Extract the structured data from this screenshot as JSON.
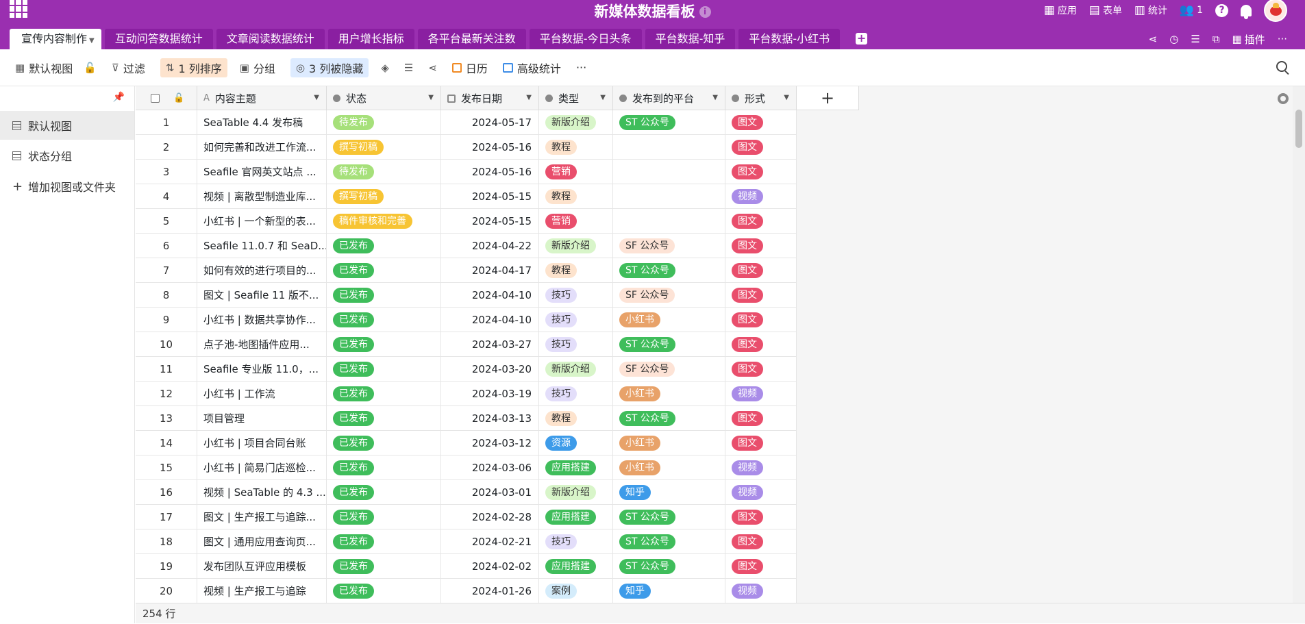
{
  "header": {
    "title": "新媒体数据看板",
    "info_icon": "i",
    "right": [
      {
        "icon": "apps-icon",
        "label": "应用"
      },
      {
        "icon": "form-icon",
        "label": "表单"
      },
      {
        "icon": "stats-icon",
        "label": "统计"
      },
      {
        "icon": "users-icon",
        "label": "1"
      }
    ],
    "help": "?"
  },
  "tabs": [
    {
      "label": "宣传内容制作",
      "active": true
    },
    {
      "label": "互动问答数据统计"
    },
    {
      "label": "文章阅读数据统计"
    },
    {
      "label": "用户增长指标"
    },
    {
      "label": "各平台最新关注数"
    },
    {
      "label": "平台数据-今日头条"
    },
    {
      "label": "平台数据-知乎"
    },
    {
      "label": "平台数据-小红书"
    }
  ],
  "tab_add": "+",
  "tab_tools": {
    "plugin_label": "插件"
  },
  "toolbar": {
    "view_label": "默认视图",
    "filter_label": "过滤",
    "sort_label": "1 列排序",
    "group_label": "分组",
    "hidden_label": "3 列被隐藏",
    "calendar_label": "日历",
    "stats_label": "高级统计",
    "more": "···"
  },
  "sidebar": {
    "items": [
      {
        "label": "默认视图",
        "active": true
      },
      {
        "label": "状态分组"
      },
      {
        "label": "增加视图或文件夹"
      }
    ],
    "add_symbol": "+"
  },
  "columns": [
    "内容主题",
    "状态",
    "发布日期",
    "类型",
    "发布到的平台",
    "形式"
  ],
  "add_column": "+",
  "tag_colors": {
    "待发布": {
      "bg": "#a6e07a",
      "fg": "#ffffff"
    },
    "撰写初稿": {
      "bg": "#f7c433",
      "fg": "#ffffff"
    },
    "稿件审核和完善": {
      "bg": "#f7c433",
      "fg": "#ffffff"
    },
    "已发布": {
      "bg": "#3fbd5b",
      "fg": "#ffffff"
    },
    "新版介绍": {
      "bg": "#d8f5c9",
      "fg": "#333333"
    },
    "教程": {
      "bg": "#fde3cd",
      "fg": "#333333"
    },
    "营销": {
      "bg": "#e94e6c",
      "fg": "#ffffff"
    },
    "技巧": {
      "bg": "#e3defa",
      "fg": "#333333"
    },
    "资源": {
      "bg": "#3d9be9",
      "fg": "#ffffff"
    },
    "应用搭建": {
      "bg": "#3fbd5b",
      "fg": "#ffffff"
    },
    "案例": {
      "bg": "#d4ecfb",
      "fg": "#333333"
    },
    "ST 公众号": {
      "bg": "#3fbd5b",
      "fg": "#ffffff"
    },
    "SF 公众号": {
      "bg": "#fde3d6",
      "fg": "#333333"
    },
    "小红书": {
      "bg": "#e8a269",
      "fg": "#ffffff"
    },
    "知乎": {
      "bg": "#3d9be9",
      "fg": "#ffffff"
    },
    "图文": {
      "bg": "#e94e6c",
      "fg": "#ffffff"
    },
    "视频": {
      "bg": "#a98ce8",
      "fg": "#ffffff"
    }
  },
  "rows": [
    {
      "n": "1",
      "title": "SeaTable 4.4 发布稿",
      "status": "待发布",
      "date": "2024-05-17",
      "type": "新版介绍",
      "platform": "ST 公众号",
      "form": "图文"
    },
    {
      "n": "2",
      "title": "如何完善和改进工作流...",
      "status": "撰写初稿",
      "date": "2024-05-16",
      "type": "教程",
      "platform": "",
      "form": "图文"
    },
    {
      "n": "3",
      "title": "Seafile 官网英文站点 ...",
      "status": "待发布",
      "date": "2024-05-16",
      "type": "营销",
      "platform": "",
      "form": "图文"
    },
    {
      "n": "4",
      "title": "视频 | 离散型制造业库...",
      "status": "撰写初稿",
      "date": "2024-05-15",
      "type": "教程",
      "platform": "",
      "form": "视频"
    },
    {
      "n": "5",
      "title": "小红书 | 一个新型的表...",
      "status": "稿件审核和完善",
      "date": "2024-05-15",
      "type": "营销",
      "platform": "",
      "form": "图文"
    },
    {
      "n": "6",
      "title": "Seafile 11.0.7 和 SeaD...",
      "status": "已发布",
      "date": "2024-04-22",
      "type": "新版介绍",
      "platform": "SF 公众号",
      "form": "图文"
    },
    {
      "n": "7",
      "title": "如何有效的进行项目的...",
      "status": "已发布",
      "date": "2024-04-17",
      "type": "教程",
      "platform": "ST 公众号",
      "form": "图文"
    },
    {
      "n": "8",
      "title": "图文 | Seafile 11 版不...",
      "status": "已发布",
      "date": "2024-04-10",
      "type": "技巧",
      "platform": "SF 公众号",
      "form": "图文"
    },
    {
      "n": "9",
      "title": "小红书 | 数据共享协作...",
      "status": "已发布",
      "date": "2024-04-10",
      "type": "技巧",
      "platform": "小红书",
      "form": "图文"
    },
    {
      "n": "10",
      "title": "点子池-地图插件应用...",
      "status": "已发布",
      "date": "2024-03-27",
      "type": "技巧",
      "platform": "ST 公众号",
      "form": "图文"
    },
    {
      "n": "11",
      "title": "Seafile 专业版 11.0，...",
      "status": "已发布",
      "date": "2024-03-20",
      "type": "新版介绍",
      "platform": "SF 公众号",
      "form": "图文"
    },
    {
      "n": "12",
      "title": "小红书 | 工作流",
      "status": "已发布",
      "date": "2024-03-19",
      "type": "技巧",
      "platform": "小红书",
      "form": "视频"
    },
    {
      "n": "13",
      "title": "项目管理",
      "status": "已发布",
      "date": "2024-03-13",
      "type": "教程",
      "platform": "ST 公众号",
      "form": "图文"
    },
    {
      "n": "14",
      "title": "小红书 | 项目合同台账",
      "status": "已发布",
      "date": "2024-03-12",
      "type": "资源",
      "platform": "小红书",
      "form": "图文"
    },
    {
      "n": "15",
      "title": "小红书 | 简易门店巡检...",
      "status": "已发布",
      "date": "2024-03-06",
      "type": "应用搭建",
      "platform": "小红书",
      "form": "视频"
    },
    {
      "n": "16",
      "title": "视频 | SeaTable 的 4.3 ...",
      "status": "已发布",
      "date": "2024-03-01",
      "type": "新版介绍",
      "platform": "知乎",
      "form": "视频"
    },
    {
      "n": "17",
      "title": "图文 | 生产报工与追踪...",
      "status": "已发布",
      "date": "2024-02-28",
      "type": "应用搭建",
      "platform": "ST 公众号",
      "form": "图文"
    },
    {
      "n": "18",
      "title": "图文 | 通用应用查询页...",
      "status": "已发布",
      "date": "2024-02-21",
      "type": "技巧",
      "platform": "ST 公众号",
      "form": "图文"
    },
    {
      "n": "19",
      "title": "发布团队互评应用模板",
      "status": "已发布",
      "date": "2024-02-02",
      "type": "应用搭建",
      "platform": "ST 公众号",
      "form": "图文"
    },
    {
      "n": "20",
      "title": "视频 | 生产报工与追踪",
      "status": "已发布",
      "date": "2024-01-26",
      "type": "案例",
      "platform": "知乎",
      "form": "视频"
    }
  ],
  "footer": {
    "row_count": "254 行"
  }
}
